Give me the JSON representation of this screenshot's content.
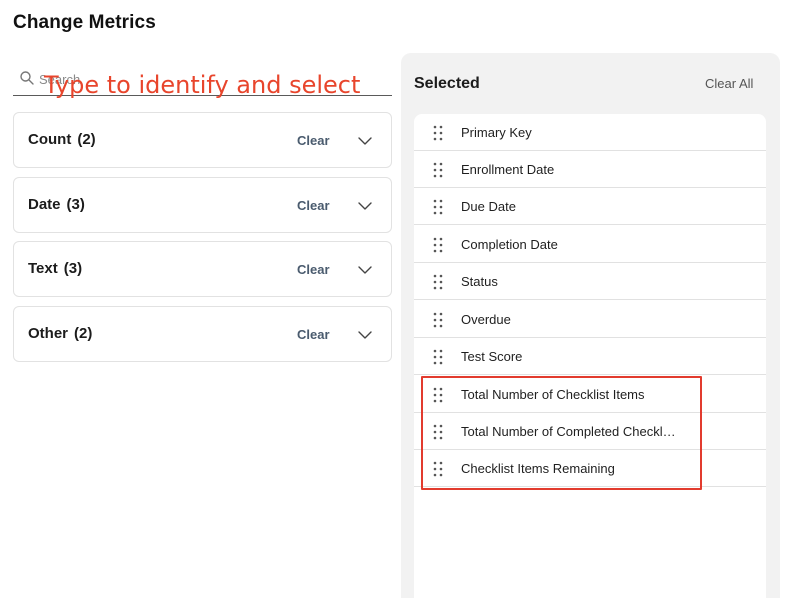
{
  "page": {
    "title": "Change Metrics"
  },
  "search": {
    "placeholder": "Search",
    "annotation": "Type to identify and select"
  },
  "groups": [
    {
      "label": "Count",
      "count": "(2)",
      "clear_label": "Clear"
    },
    {
      "label": "Date",
      "count": "(3)",
      "clear_label": "Clear"
    },
    {
      "label": "Text",
      "count": "(3)",
      "clear_label": "Clear"
    },
    {
      "label": "Other",
      "count": "(2)",
      "clear_label": "Clear"
    }
  ],
  "selected": {
    "title": "Selected",
    "clear_all_label": "Clear All",
    "items": [
      {
        "label": "Primary Key"
      },
      {
        "label": "Enrollment Date"
      },
      {
        "label": "Due Date"
      },
      {
        "label": "Completion Date"
      },
      {
        "label": "Status"
      },
      {
        "label": "Overdue"
      },
      {
        "label": "Test Score"
      },
      {
        "label": "Total Number of Checklist Items"
      },
      {
        "label": "Total Number of Completed Checkli..."
      },
      {
        "label": "Checklist Items Remaining"
      }
    ]
  },
  "colors": {
    "annotation": "#e8452c",
    "highlight": "#e23b2e",
    "clear_link": "#4a5b6e",
    "panel_bg": "#f2f2f2"
  },
  "icons": {
    "search": "search-icon",
    "chevron": "chevron-down-icon",
    "drag": "drag-handle-icon"
  }
}
